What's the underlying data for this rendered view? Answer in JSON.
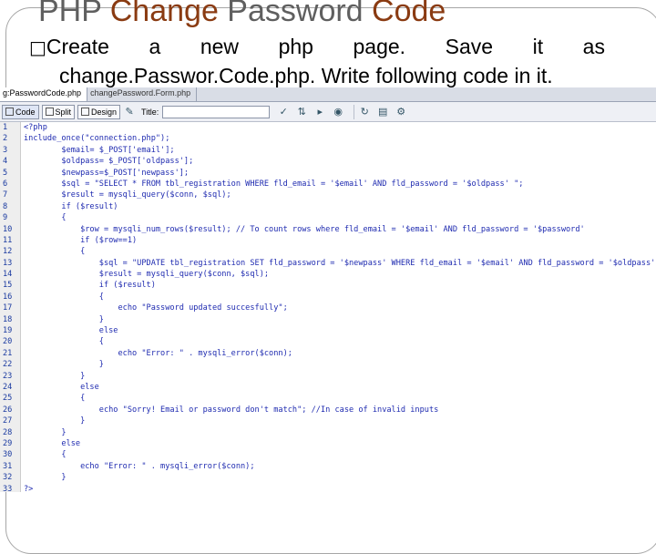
{
  "slide": {
    "title_part1": "PHP ",
    "title_part2": "Change ",
    "title_part3": "Password ",
    "title_part4": "Code",
    "bullet_symbol": "□",
    "bullet_words": [
      "Create",
      "a",
      "new",
      "php",
      "page.",
      "Save",
      "it",
      "as"
    ],
    "bullet_line2": "change.Passwor.Code.php. Write following code in it."
  },
  "ide": {
    "tabs": [
      {
        "label": "g:PasswordCode.php",
        "active": true
      },
      {
        "label": "changePassword.Form.php",
        "active": false
      }
    ],
    "toolbar": {
      "code_label": "Code",
      "split_label": "Split",
      "design_label": "Design",
      "title_label": "Title:",
      "title_value": "",
      "icons": [
        "validate-icon",
        "file-manage-icon",
        "preview-icon",
        "globe-icon",
        "refresh-icon",
        "view-options-icon",
        "visual-aids-icon"
      ]
    },
    "code_lines": [
      {
        "n": "1",
        "text": "<?php"
      },
      {
        "n": "2",
        "text": "include_once(\"connection.php\");"
      },
      {
        "n": "3",
        "text": "        $email= $_POST['email'];"
      },
      {
        "n": "4",
        "text": "        $oldpass= $_POST['oldpass'];"
      },
      {
        "n": "5",
        "text": "        $newpass=$_POST['newpass'];"
      },
      {
        "n": "6",
        "text": "        $sql = \"SELECT * FROM tbl_registration WHERE fld_email = '$email' AND fld_password = '$oldpass' \";"
      },
      {
        "n": "7",
        "text": "        $result = mysqli_query($conn, $sql);"
      },
      {
        "n": "8",
        "text": "        if ($result)"
      },
      {
        "n": "9",
        "text": "        {"
      },
      {
        "n": "10",
        "text": "            $row = mysqli_num_rows($result); // To count rows where fld_email = '$email' AND fld_password = '$password'"
      },
      {
        "n": "11",
        "text": "            if ($row==1)"
      },
      {
        "n": "12",
        "text": "            {"
      },
      {
        "n": "13",
        "text": "                $sql = \"UPDATE tbl_registration SET fld_password = '$newpass' WHERE fld_email = '$email' AND fld_password = '$oldpass' \";"
      },
      {
        "n": "14",
        "text": "                $result = mysqli_query($conn, $sql);"
      },
      {
        "n": "15",
        "text": "                if ($result)"
      },
      {
        "n": "16",
        "text": "                {"
      },
      {
        "n": "17",
        "text": "                    echo \"Password updated succesfully\";"
      },
      {
        "n": "18",
        "text": "                }"
      },
      {
        "n": "19",
        "text": "                else"
      },
      {
        "n": "20",
        "text": "                {"
      },
      {
        "n": "21",
        "text": "                    echo \"Error: \" . mysqli_error($conn);"
      },
      {
        "n": "22",
        "text": "                }"
      },
      {
        "n": "23",
        "text": "            }"
      },
      {
        "n": "24",
        "text": "            else"
      },
      {
        "n": "25",
        "text": "            {"
      },
      {
        "n": "26",
        "text": "                echo \"Sorry! Email or password don't match\"; //In case of invalid inputs"
      },
      {
        "n": "27",
        "text": "            }"
      },
      {
        "n": "28",
        "text": "        }"
      },
      {
        "n": "29",
        "text": "        else"
      },
      {
        "n": "30",
        "text": "        {"
      },
      {
        "n": "31",
        "text": "            echo \"Error: \" . mysqli_error($conn);"
      },
      {
        "n": "32",
        "text": "        }"
      },
      {
        "n": "33",
        "text": "?>"
      }
    ]
  },
  "colors": {
    "title_gray": "#5f5f5f",
    "title_brown": "#8a3b12",
    "code_blue": "#1f2bb0",
    "line_number_blue": "#1a3aa0"
  }
}
